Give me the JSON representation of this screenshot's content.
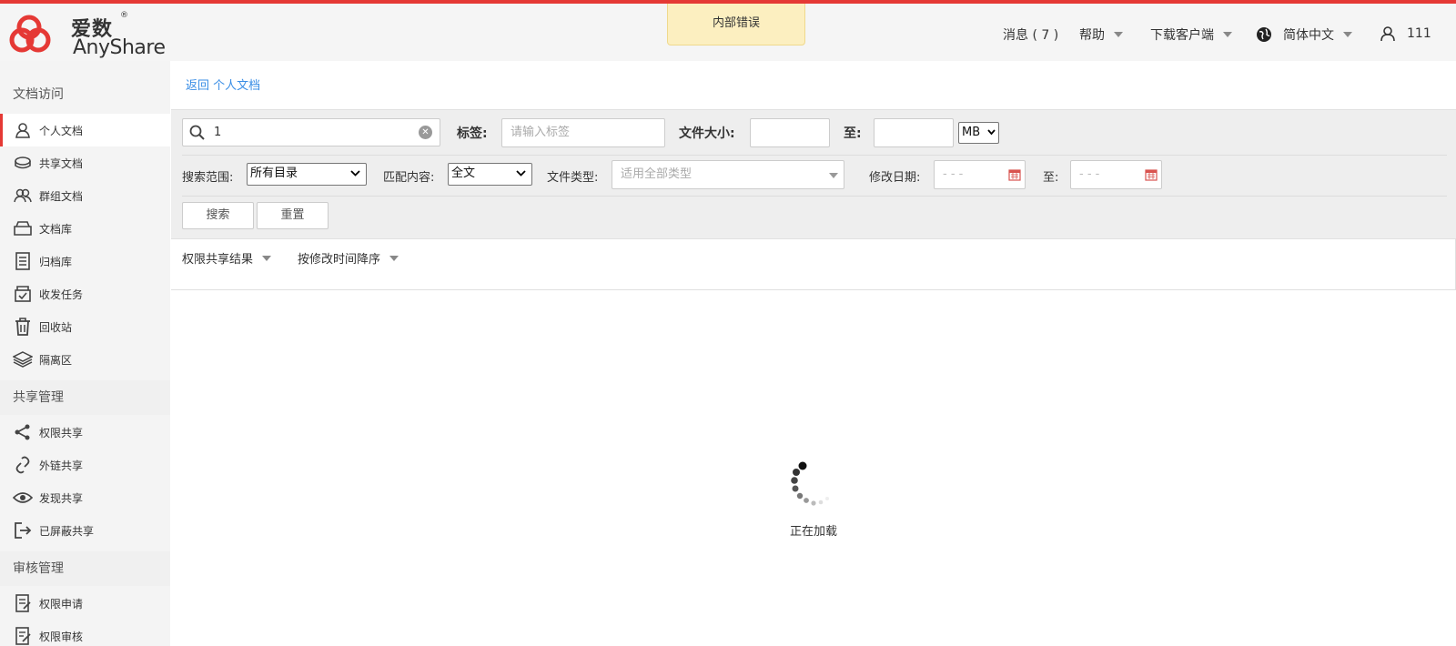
{
  "brand": {
    "name_cn": "爱数",
    "name_en": "AnyShare",
    "reg_mark": "®"
  },
  "toast": {
    "text": "内部错误"
  },
  "topnav": {
    "messages": "消息 ( 7 )",
    "help": "帮助",
    "download": "下载客户端",
    "language": "简体中文",
    "user": "111"
  },
  "sidebar": {
    "group1": "文档访问",
    "items1": [
      {
        "label": "个人文档",
        "icon": "person-icon"
      },
      {
        "label": "共享文档",
        "icon": "shared-docs-icon"
      },
      {
        "label": "群组文档",
        "icon": "group-icon"
      },
      {
        "label": "文档库",
        "icon": "library-icon"
      },
      {
        "label": "归档库",
        "icon": "archive-icon"
      },
      {
        "label": "收发任务",
        "icon": "task-icon"
      },
      {
        "label": "回收站",
        "icon": "trash-icon"
      },
      {
        "label": "隔离区",
        "icon": "layers-icon"
      }
    ],
    "group2": "共享管理",
    "items2": [
      {
        "label": "权限共享",
        "icon": "share-icon"
      },
      {
        "label": "外链共享",
        "icon": "link-icon"
      },
      {
        "label": "发现共享",
        "icon": "eye-icon"
      },
      {
        "label": "已屏蔽共享",
        "icon": "exit-icon"
      }
    ],
    "group3": "审核管理",
    "items3": [
      {
        "label": "权限申请",
        "icon": "apply-icon"
      },
      {
        "label": "权限审核",
        "icon": "review-icon"
      }
    ]
  },
  "main": {
    "back_link": "返回 个人文档",
    "search": {
      "query": "1",
      "tag_label": "标签:",
      "tag_placeholder": "请输入标签",
      "size_label": "文件大小:",
      "size_to_label": "至:",
      "size_unit": "MB",
      "scope_label": "搜索范围:",
      "scope_value": "所有目录",
      "match_label": "匹配内容:",
      "match_value": "全文",
      "type_label": "文件类型:",
      "type_placeholder": "适用全部类型",
      "date_label": "修改日期:",
      "date_from_placeholder": "- - -",
      "date_to_label": "至:",
      "date_to_placeholder": "- - -",
      "search_button": "搜索",
      "reset_button": "重置"
    },
    "results": {
      "filter": "权限共享结果",
      "sort": "按修改时间降序"
    },
    "loading_text": "正在加载"
  }
}
